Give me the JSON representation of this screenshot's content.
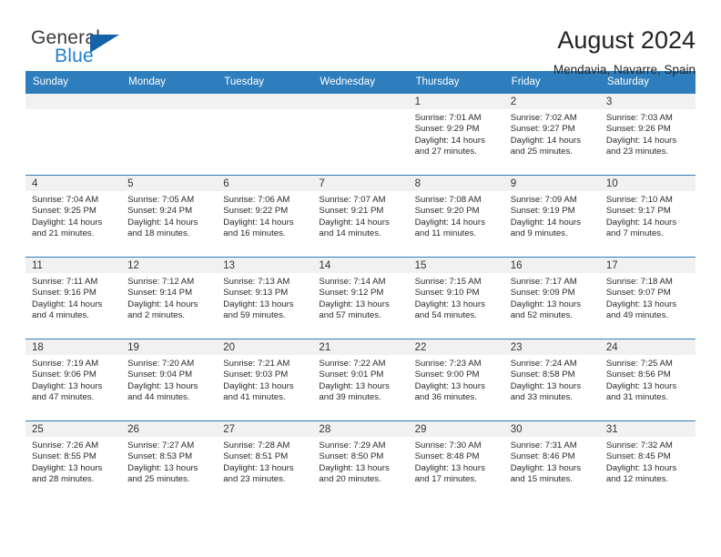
{
  "brand": {
    "name_top": "General",
    "name_bottom": "Blue",
    "accent_color": "#1463a8",
    "text_color": "#3b3b3b"
  },
  "header": {
    "title": "August 2024",
    "subtitle": "Mendavia, Navarre, Spain"
  },
  "theme": {
    "header_blue": "#2e7ebd",
    "daynum_band": "#f1f1f1"
  },
  "weekday_headers": [
    "Sunday",
    "Monday",
    "Tuesday",
    "Wednesday",
    "Thursday",
    "Friday",
    "Saturday"
  ],
  "labels": {
    "sunrise_prefix": "Sunrise:",
    "sunset_prefix": "Sunset:",
    "daylight_prefix": "Daylight:"
  },
  "weeks": [
    [
      {
        "day": "",
        "empty": true
      },
      {
        "day": "",
        "empty": true
      },
      {
        "day": "",
        "empty": true
      },
      {
        "day": "",
        "empty": true
      },
      {
        "day": "1",
        "sunrise": "Sunrise: 7:01 AM",
        "sunset": "Sunset: 9:29 PM",
        "daylight_line1": "Daylight: 14 hours",
        "daylight_line2": "and 27 minutes."
      },
      {
        "day": "2",
        "sunrise": "Sunrise: 7:02 AM",
        "sunset": "Sunset: 9:27 PM",
        "daylight_line1": "Daylight: 14 hours",
        "daylight_line2": "and 25 minutes."
      },
      {
        "day": "3",
        "sunrise": "Sunrise: 7:03 AM",
        "sunset": "Sunset: 9:26 PM",
        "daylight_line1": "Daylight: 14 hours",
        "daylight_line2": "and 23 minutes."
      }
    ],
    [
      {
        "day": "4",
        "sunrise": "Sunrise: 7:04 AM",
        "sunset": "Sunset: 9:25 PM",
        "daylight_line1": "Daylight: 14 hours",
        "daylight_line2": "and 21 minutes."
      },
      {
        "day": "5",
        "sunrise": "Sunrise: 7:05 AM",
        "sunset": "Sunset: 9:24 PM",
        "daylight_line1": "Daylight: 14 hours",
        "daylight_line2": "and 18 minutes."
      },
      {
        "day": "6",
        "sunrise": "Sunrise: 7:06 AM",
        "sunset": "Sunset: 9:22 PM",
        "daylight_line1": "Daylight: 14 hours",
        "daylight_line2": "and 16 minutes."
      },
      {
        "day": "7",
        "sunrise": "Sunrise: 7:07 AM",
        "sunset": "Sunset: 9:21 PM",
        "daylight_line1": "Daylight: 14 hours",
        "daylight_line2": "and 14 minutes."
      },
      {
        "day": "8",
        "sunrise": "Sunrise: 7:08 AM",
        "sunset": "Sunset: 9:20 PM",
        "daylight_line1": "Daylight: 14 hours",
        "daylight_line2": "and 11 minutes."
      },
      {
        "day": "9",
        "sunrise": "Sunrise: 7:09 AM",
        "sunset": "Sunset: 9:19 PM",
        "daylight_line1": "Daylight: 14 hours",
        "daylight_line2": "and 9 minutes."
      },
      {
        "day": "10",
        "sunrise": "Sunrise: 7:10 AM",
        "sunset": "Sunset: 9:17 PM",
        "daylight_line1": "Daylight: 14 hours",
        "daylight_line2": "and 7 minutes."
      }
    ],
    [
      {
        "day": "11",
        "sunrise": "Sunrise: 7:11 AM",
        "sunset": "Sunset: 9:16 PM",
        "daylight_line1": "Daylight: 14 hours",
        "daylight_line2": "and 4 minutes."
      },
      {
        "day": "12",
        "sunrise": "Sunrise: 7:12 AM",
        "sunset": "Sunset: 9:14 PM",
        "daylight_line1": "Daylight: 14 hours",
        "daylight_line2": "and 2 minutes."
      },
      {
        "day": "13",
        "sunrise": "Sunrise: 7:13 AM",
        "sunset": "Sunset: 9:13 PM",
        "daylight_line1": "Daylight: 13 hours",
        "daylight_line2": "and 59 minutes."
      },
      {
        "day": "14",
        "sunrise": "Sunrise: 7:14 AM",
        "sunset": "Sunset: 9:12 PM",
        "daylight_line1": "Daylight: 13 hours",
        "daylight_line2": "and 57 minutes."
      },
      {
        "day": "15",
        "sunrise": "Sunrise: 7:15 AM",
        "sunset": "Sunset: 9:10 PM",
        "daylight_line1": "Daylight: 13 hours",
        "daylight_line2": "and 54 minutes."
      },
      {
        "day": "16",
        "sunrise": "Sunrise: 7:17 AM",
        "sunset": "Sunset: 9:09 PM",
        "daylight_line1": "Daylight: 13 hours",
        "daylight_line2": "and 52 minutes."
      },
      {
        "day": "17",
        "sunrise": "Sunrise: 7:18 AM",
        "sunset": "Sunset: 9:07 PM",
        "daylight_line1": "Daylight: 13 hours",
        "daylight_line2": "and 49 minutes."
      }
    ],
    [
      {
        "day": "18",
        "sunrise": "Sunrise: 7:19 AM",
        "sunset": "Sunset: 9:06 PM",
        "daylight_line1": "Daylight: 13 hours",
        "daylight_line2": "and 47 minutes."
      },
      {
        "day": "19",
        "sunrise": "Sunrise: 7:20 AM",
        "sunset": "Sunset: 9:04 PM",
        "daylight_line1": "Daylight: 13 hours",
        "daylight_line2": "and 44 minutes."
      },
      {
        "day": "20",
        "sunrise": "Sunrise: 7:21 AM",
        "sunset": "Sunset: 9:03 PM",
        "daylight_line1": "Daylight: 13 hours",
        "daylight_line2": "and 41 minutes."
      },
      {
        "day": "21",
        "sunrise": "Sunrise: 7:22 AM",
        "sunset": "Sunset: 9:01 PM",
        "daylight_line1": "Daylight: 13 hours",
        "daylight_line2": "and 39 minutes."
      },
      {
        "day": "22",
        "sunrise": "Sunrise: 7:23 AM",
        "sunset": "Sunset: 9:00 PM",
        "daylight_line1": "Daylight: 13 hours",
        "daylight_line2": "and 36 minutes."
      },
      {
        "day": "23",
        "sunrise": "Sunrise: 7:24 AM",
        "sunset": "Sunset: 8:58 PM",
        "daylight_line1": "Daylight: 13 hours",
        "daylight_line2": "and 33 minutes."
      },
      {
        "day": "24",
        "sunrise": "Sunrise: 7:25 AM",
        "sunset": "Sunset: 8:56 PM",
        "daylight_line1": "Daylight: 13 hours",
        "daylight_line2": "and 31 minutes."
      }
    ],
    [
      {
        "day": "25",
        "sunrise": "Sunrise: 7:26 AM",
        "sunset": "Sunset: 8:55 PM",
        "daylight_line1": "Daylight: 13 hours",
        "daylight_line2": "and 28 minutes."
      },
      {
        "day": "26",
        "sunrise": "Sunrise: 7:27 AM",
        "sunset": "Sunset: 8:53 PM",
        "daylight_line1": "Daylight: 13 hours",
        "daylight_line2": "and 25 minutes."
      },
      {
        "day": "27",
        "sunrise": "Sunrise: 7:28 AM",
        "sunset": "Sunset: 8:51 PM",
        "daylight_line1": "Daylight: 13 hours",
        "daylight_line2": "and 23 minutes."
      },
      {
        "day": "28",
        "sunrise": "Sunrise: 7:29 AM",
        "sunset": "Sunset: 8:50 PM",
        "daylight_line1": "Daylight: 13 hours",
        "daylight_line2": "and 20 minutes."
      },
      {
        "day": "29",
        "sunrise": "Sunrise: 7:30 AM",
        "sunset": "Sunset: 8:48 PM",
        "daylight_line1": "Daylight: 13 hours",
        "daylight_line2": "and 17 minutes."
      },
      {
        "day": "30",
        "sunrise": "Sunrise: 7:31 AM",
        "sunset": "Sunset: 8:46 PM",
        "daylight_line1": "Daylight: 13 hours",
        "daylight_line2": "and 15 minutes."
      },
      {
        "day": "31",
        "sunrise": "Sunrise: 7:32 AM",
        "sunset": "Sunset: 8:45 PM",
        "daylight_line1": "Daylight: 13 hours",
        "daylight_line2": "and 12 minutes."
      }
    ]
  ]
}
